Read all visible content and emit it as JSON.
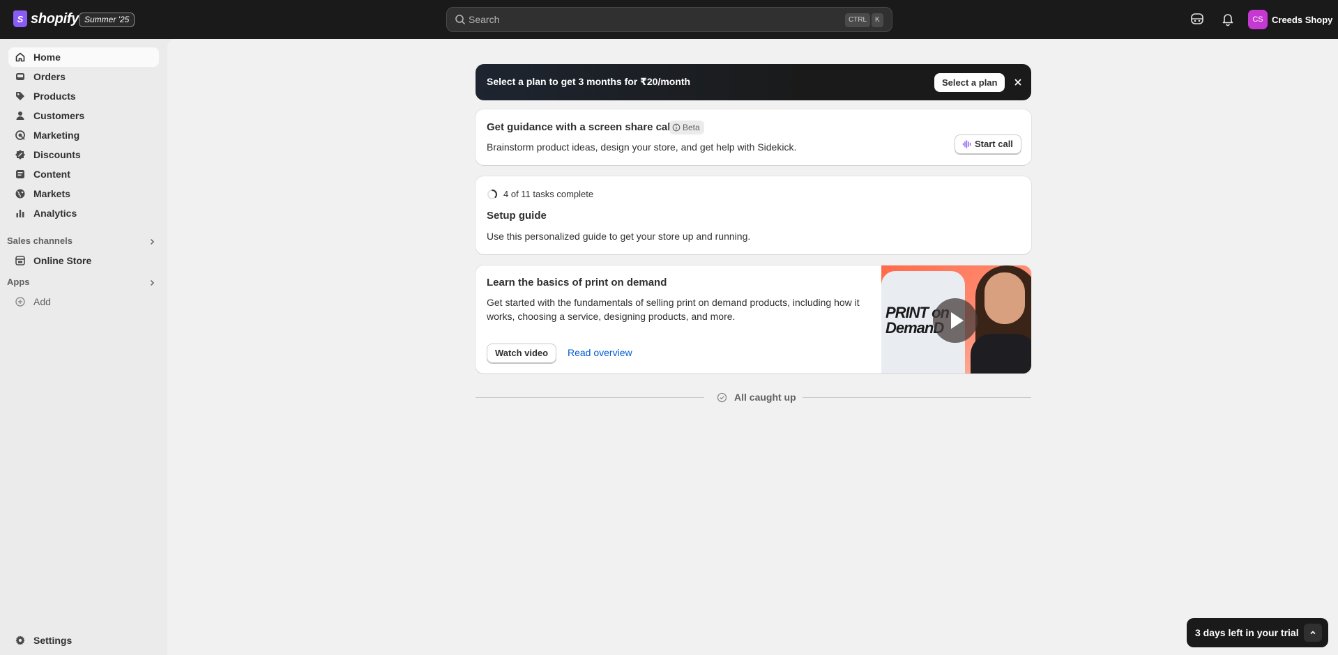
{
  "topbar": {
    "logo_text": "shopify",
    "edition_badge": "Summer '25",
    "search": {
      "placeholder": "Search",
      "shortcut_ctrl": "CTRL",
      "shortcut_key": "K"
    },
    "account": {
      "initials": "CS",
      "store_name": "Creeds Shopy",
      "avatar_color": "#c638d2"
    }
  },
  "sidebar": {
    "items": [
      {
        "label": "Home",
        "icon": "home-icon",
        "active": true
      },
      {
        "label": "Orders",
        "icon": "inbox-icon"
      },
      {
        "label": "Products",
        "icon": "tag-icon"
      },
      {
        "label": "Customers",
        "icon": "person-icon"
      },
      {
        "label": "Marketing",
        "icon": "target-icon"
      },
      {
        "label": "Discounts",
        "icon": "discount-icon"
      },
      {
        "label": "Content",
        "icon": "content-icon"
      },
      {
        "label": "Markets",
        "icon": "globe-icon"
      },
      {
        "label": "Analytics",
        "icon": "bar-chart-icon"
      }
    ],
    "sales_channels": {
      "title": "Sales channels",
      "items": [
        {
          "label": "Online Store",
          "icon": "store-icon"
        }
      ]
    },
    "apps": {
      "title": "Apps",
      "items": [
        {
          "label": "Add",
          "icon": "plus-circle-icon"
        }
      ]
    },
    "settings": {
      "label": "Settings",
      "icon": "gear-icon"
    }
  },
  "banner": {
    "text": "Select a plan to get 3 months for ₹20/month",
    "button": "Select a plan"
  },
  "screen_share": {
    "title": "Get guidance with a screen share call",
    "badge": "Beta",
    "description": "Brainstorm product ideas, design your store, and get help with Sidekick.",
    "button": "Start call"
  },
  "setup_guide": {
    "progress_text": "4 of 11 tasks complete",
    "tasks_complete": 4,
    "tasks_total": 11,
    "title": "Setup guide",
    "description": "Use this personalized guide to get your store up and running."
  },
  "print_on_demand": {
    "title": "Learn the basics of print on demand",
    "description": "Get started with the fundamentals of selling print on demand products, including how it works, choosing a service, designing products, and more.",
    "watch_button": "Watch video",
    "read_link": "Read overview",
    "thumbnail_text_1": "PRINT on",
    "thumbnail_text_2": "DemanD"
  },
  "caught_up": {
    "text": "All caught up"
  },
  "trial": {
    "text": "3 days left in your trial"
  },
  "colors": {
    "topbar": "#1a1a1a",
    "link": "#005bd3",
    "accent": "#8a5cf6"
  }
}
